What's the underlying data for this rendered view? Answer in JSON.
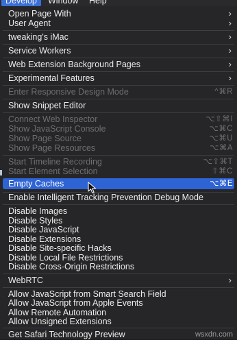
{
  "menubar": {
    "items": [
      "Develop",
      "Window",
      "Help"
    ]
  },
  "menu": {
    "open_page_with": "Open Page With",
    "user_agent": "User Agent",
    "device": "tweaking's iMac",
    "service_workers": "Service Workers",
    "web_extension_pages": "Web Extension Background Pages",
    "experimental_features": "Experimental Features",
    "responsive_design": {
      "label": "Enter Responsive Design Mode",
      "shortcut": "^⌘R"
    },
    "snippet_editor": "Show Snippet Editor",
    "connect_inspector": {
      "label": "Connect Web Inspector",
      "shortcut": "⌥⇧⌘I"
    },
    "js_console": {
      "label": "Show JavaScript Console",
      "shortcut": "⌥⌘C"
    },
    "page_source": {
      "label": "Show Page Source",
      "shortcut": "⌥⌘U"
    },
    "page_resources": {
      "label": "Show Page Resources",
      "shortcut": "⌥⌘A"
    },
    "timeline": {
      "label": "Start Timeline Recording",
      "shortcut": "⌥⇧⌘T"
    },
    "element_selection": {
      "label": "Start Element Selection",
      "shortcut": "⇧⌘C"
    },
    "empty_caches": {
      "label": "Empty Caches",
      "shortcut": "⌥⌘E"
    },
    "itp_debug": "Enable Intelligent Tracking Prevention Debug Mode",
    "disable_images": "Disable Images",
    "disable_styles": "Disable Styles",
    "disable_javascript": "Disable JavaScript",
    "disable_extensions": "Disable Extensions",
    "disable_site_hacks": "Disable Site-specific Hacks",
    "disable_local_file": "Disable Local File Restrictions",
    "disable_cross_origin": "Disable Cross-Origin Restrictions",
    "webrtc": "WebRTC",
    "allow_smart_search": "Allow JavaScript from Smart Search Field",
    "allow_apple_events": "Allow JavaScript from Apple Events",
    "allow_remote_automation": "Allow Remote Automation",
    "allow_unsigned_extensions": "Allow Unsigned Extensions",
    "safari_tech_preview": "Get Safari Technology Preview"
  },
  "watermark": "wsxdn.com"
}
